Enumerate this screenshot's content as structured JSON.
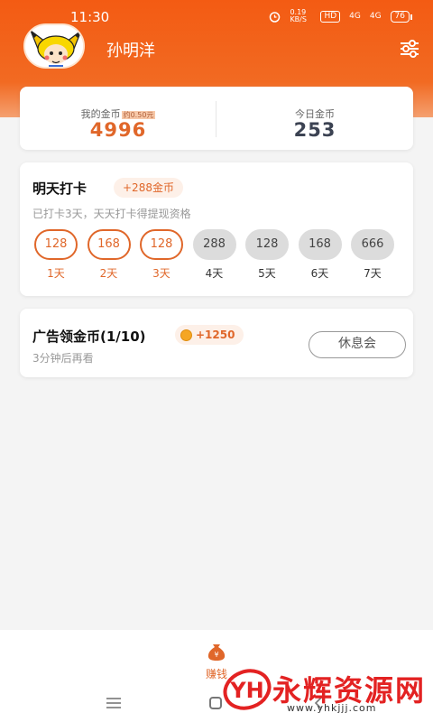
{
  "status_bar": {
    "time": "11:30",
    "net_speed": "0.19 KB/S",
    "hd": "HD",
    "signal1": "4G",
    "signal2": "4G",
    "battery": "76"
  },
  "user": {
    "name": "孙明洋"
  },
  "coins": {
    "my_label": "我的金币",
    "my_approx": "约0.50元",
    "my_value": "4996",
    "today_label": "今日金币",
    "today_value": "253"
  },
  "checkin": {
    "title": "明天打卡",
    "bonus": "+288金币",
    "subtitle": "已打卡3天，天天打卡得提现资格",
    "days": [
      {
        "value": "128",
        "label": "1天",
        "done": true
      },
      {
        "value": "168",
        "label": "2天",
        "done": true
      },
      {
        "value": "128",
        "label": "3天",
        "done": true
      },
      {
        "value": "288",
        "label": "4天",
        "done": false
      },
      {
        "value": "128",
        "label": "5天",
        "done": false
      },
      {
        "value": "168",
        "label": "6天",
        "done": false
      },
      {
        "value": "666",
        "label": "7天",
        "done": false
      }
    ]
  },
  "ad": {
    "title": "广告领金币(1/10)",
    "reward": "+1250",
    "subtitle": "3分钟后再看",
    "button": "休息会"
  },
  "tabbar": {
    "earn_label": "赚钱"
  },
  "watermark": {
    "title": "永辉资源网",
    "url": "www.yhkjjj.com",
    "logo_text": "YH"
  },
  "colors": {
    "brand": "#f35b13",
    "accent": "#e0672a",
    "watermark_red": "#e32222"
  },
  "icons": {
    "settings": "sliders-icon",
    "coin": "coin-icon",
    "earn": "money-bag-icon",
    "nav_menu": "menu-icon",
    "nav_home": "home-icon",
    "nav_back": "back-icon"
  }
}
